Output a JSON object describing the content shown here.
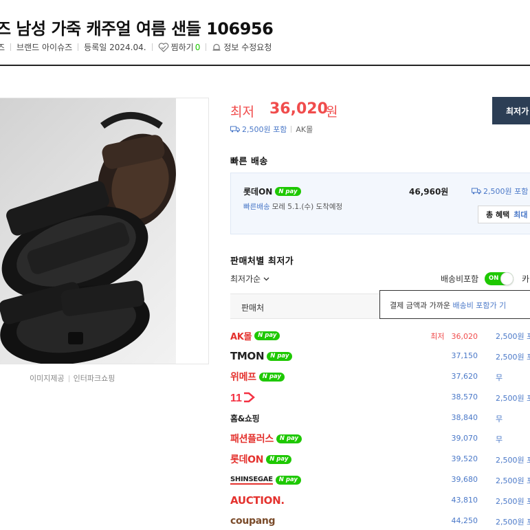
{
  "product": {
    "title": "즈 남성 가죽 캐주얼 여름 샌들 106956",
    "meta_cut": "즈",
    "brand_label": "브랜드",
    "brand_value": "아이슈즈",
    "reg_label": "등록일",
    "reg_value": "2024.04.",
    "wish_label": "찜하기",
    "wish_count": "0",
    "report_label": "정보 수정요청"
  },
  "image": {
    "caption_label": "이미지제공",
    "caption_source": "인터파크쇼핑"
  },
  "price": {
    "label": "최저",
    "value": "36,020",
    "unit": "원",
    "shipping": "2,500원 포함",
    "mall": "AK몰",
    "buy_button": "최저가"
  },
  "fast_delivery": {
    "title": "빠른 배송",
    "shop": "롯데ON",
    "npay": "N pay",
    "eta_label": "빠른배송",
    "eta_text": "모레 5.1.(수) 도착예정",
    "price": "46,960원",
    "shipping": "2,500원 포함",
    "benefit_label": "총 혜택",
    "benefit_link": "최대"
  },
  "seller_section": {
    "title": "판매처별 최저가",
    "sort_label": "최저가순",
    "ship_toggle_label": "배송비포함",
    "toggle_text": "ON",
    "card_label": "카",
    "column_seller": "판매처",
    "tooltip_text": "결제 금액과 가까운 ",
    "tooltip_link": "배송비 포함가 기",
    "min_tag": "최저"
  },
  "sellers": [
    {
      "name": "AK몰",
      "price": "36,020",
      "shipping": "2,500원 포",
      "npay": true,
      "color": "#e4322e"
    },
    {
      "name": "TMON",
      "price": "37,150",
      "shipping": "2,500원 포",
      "npay": true,
      "color": "#222222"
    },
    {
      "name": "위메프",
      "price": "37,620",
      "shipping": "무",
      "npay": true,
      "color": "#e4322e"
    },
    {
      "name": "11번가",
      "price": "38,570",
      "shipping": "2,500원 포",
      "npay": false,
      "color": "#f43142"
    },
    {
      "name": "홈&쇼핑",
      "price": "38,840",
      "shipping": "무",
      "npay": false,
      "color": "#222222"
    },
    {
      "name": "패션플러스",
      "price": "39,070",
      "shipping": "무",
      "npay": true,
      "color": "#e4322e"
    },
    {
      "name": "롯데ON",
      "price": "39,520",
      "shipping": "2,500원 포",
      "npay": true,
      "color": "#e4322e"
    },
    {
      "name": "SHINSEGAE",
      "price": "39,680",
      "shipping": "2,500원 포",
      "npay": true,
      "color": "#222222"
    },
    {
      "name": "AUCTION.",
      "price": "43,810",
      "shipping": "2,500원 포",
      "npay": false,
      "color": "#e4322e"
    },
    {
      "name": "coupang",
      "price": "44,250",
      "shipping": "2,500원 포",
      "npay": false,
      "color": "#7a4b2a"
    }
  ],
  "colors": {
    "accent_red": "#f04c4c",
    "link_blue": "#4a78c8",
    "npay_green": "#1ec800",
    "button_navy": "#2c3e55"
  }
}
